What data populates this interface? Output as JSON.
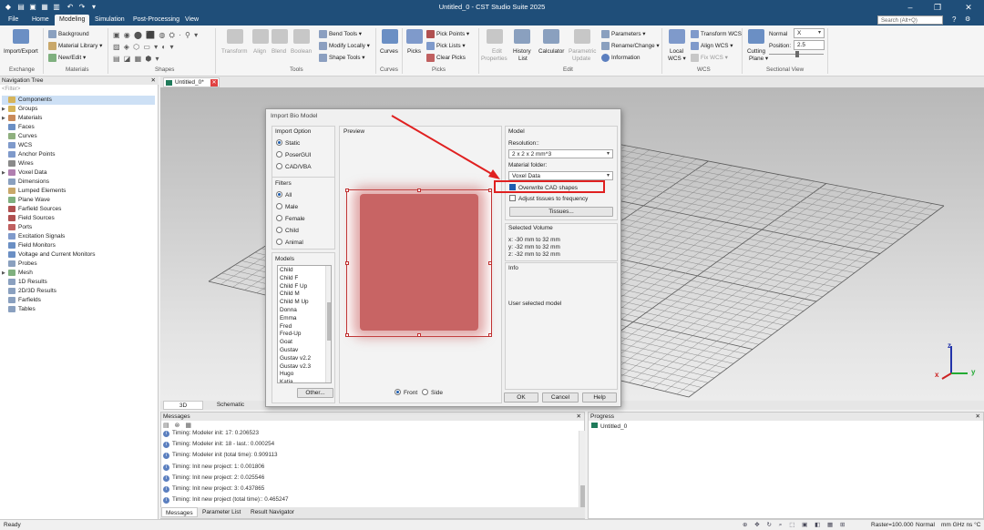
{
  "window": {
    "title": "Untitled_0 - CST Studio Suite 2025"
  },
  "menu": {
    "file": "File",
    "home": "Home",
    "modeling": "Modeling",
    "simulation": "Simulation",
    "postprocessing": "Post-Processing",
    "view": "View",
    "search_placeholder": "Search (Alt+Q)"
  },
  "ribbon": {
    "import_export": "Import/Export",
    "background": "Background",
    "material_library": "Material Library",
    "new_edit": "New/Edit",
    "transform": "Transform",
    "align": "Align",
    "blend": "Blend",
    "boolean": "Boolean",
    "bend_tools": "Bend Tools",
    "modify_locally": "Modify Locally",
    "shape_tools": "Shape Tools",
    "curves": "Curves",
    "picks": "Picks",
    "pick_points": "Pick Points",
    "pick_lists": "Pick Lists",
    "clear_picks": "Clear Picks",
    "edit_properties": "Edit Properties",
    "history_list": "History List",
    "calculator": "Calculator",
    "parametric_update": "Parametric Update",
    "parameters": "Parameters",
    "rename_change": "Rename/Change",
    "information": "Information",
    "local_wcs": "Local WCS",
    "transform_wcs": "Transform WCS",
    "align_wcs": "Align WCS",
    "fix_wcs": "Fix WCS",
    "cutting_plane": "Cutting Plane",
    "normal_label": "Normal",
    "normal_value": "X",
    "position_label": "Position:",
    "position_value": "2.5",
    "groups": {
      "exchange": "Exchange",
      "materials": "Materials",
      "shapes": "Shapes",
      "tools": "Tools",
      "curves": "Curves",
      "picks": "Picks",
      "edit": "Edit",
      "wcs": "WCS",
      "sectional": "Sectional View"
    }
  },
  "doc_tab": "Untitled_0*",
  "nav": {
    "title": "Navigation Tree",
    "filter_placeholder": "<Filter>",
    "items": [
      "Components",
      "Groups",
      "Materials",
      "Faces",
      "Curves",
      "WCS",
      "Anchor Points",
      "Wires",
      "Voxel Data",
      "Dimensions",
      "Lumped Elements",
      "Plane Wave",
      "Farfield Sources",
      "Field Sources",
      "Ports",
      "Excitation Signals",
      "Field Monitors",
      "Voltage and Current Monitors",
      "Probes",
      "Mesh",
      "1D Results",
      "2D/3D Results",
      "Farfields",
      "Tables"
    ]
  },
  "view_tabs": {
    "t3d": "3D",
    "schematic": "Schematic"
  },
  "axes": {
    "x": "x",
    "y": "y",
    "z": "z"
  },
  "dialog": {
    "title": "Import Bio Model",
    "import_option": {
      "label": "Import Option",
      "options": [
        "Static",
        "PoserGUI",
        "CAD/VBA"
      ],
      "selected": "Static"
    },
    "filters": {
      "label": "Filters",
      "options": [
        "All",
        "Male",
        "Female",
        "Child",
        "Animal"
      ],
      "selected": "All"
    },
    "models": {
      "label": "Models",
      "items": [
        "Child",
        "Child F",
        "Child F Up",
        "Child M",
        "Child M Up",
        "Donna",
        "Emma",
        "Fred",
        "Fred-Up",
        "Goat",
        "Gustav",
        "Gustav v2.2",
        "Gustav v2.3",
        "Hugo",
        "Katja"
      ]
    },
    "other_button": "Other...",
    "preview": {
      "label": "Preview",
      "front": "Front",
      "side": "Side",
      "selected": "Front"
    },
    "model": {
      "label": "Model",
      "resolution_label": "Resolution::",
      "resolution_value": "2 x 2 x 2 mm^3",
      "material_folder_label": "Material folder:",
      "material_folder_value": "Voxel Data",
      "overwrite_label": "Overwrite CAD shapes",
      "adjust_label": "Adjust tissues to frequency",
      "tissues_button": "Tissues..."
    },
    "selected_volume": {
      "label": "Selected Volume",
      "x": "x: -30 mm to 32 mm",
      "y": "y: -32 mm to 32 mm",
      "z": "z: -32 mm to 32 mm"
    },
    "info": {
      "label": "Info",
      "text": "User selected model"
    },
    "ok": "OK",
    "cancel": "Cancel",
    "help": "Help"
  },
  "messages": {
    "title": "Messages",
    "lines": [
      "Timing: Modeler init: 17: 0.206523",
      "Timing: Modeler init: 18 - last.: 0.000254",
      "Timing: Modeler init (total time): 0.909113",
      "Timing: Init new project: 1: 0.001806",
      "Timing: Init new project: 2: 0.025546",
      "Timing: Init new project: 3: 0.437865",
      "Timing: Init new project (total time):: 0.465247"
    ],
    "tabs": [
      "Messages",
      "Parameter List",
      "Result Navigator"
    ]
  },
  "progress": {
    "title": "Progress",
    "item": "Untitled_0"
  },
  "status": {
    "ready": "Ready",
    "raster": "Raster=100.000",
    "mode": "Normal",
    "units": "mm  GHz  ns  °C"
  },
  "colors": {
    "accent": "#1f4e79",
    "highlight": "#e02020",
    "preview_fill": "#c86464"
  }
}
